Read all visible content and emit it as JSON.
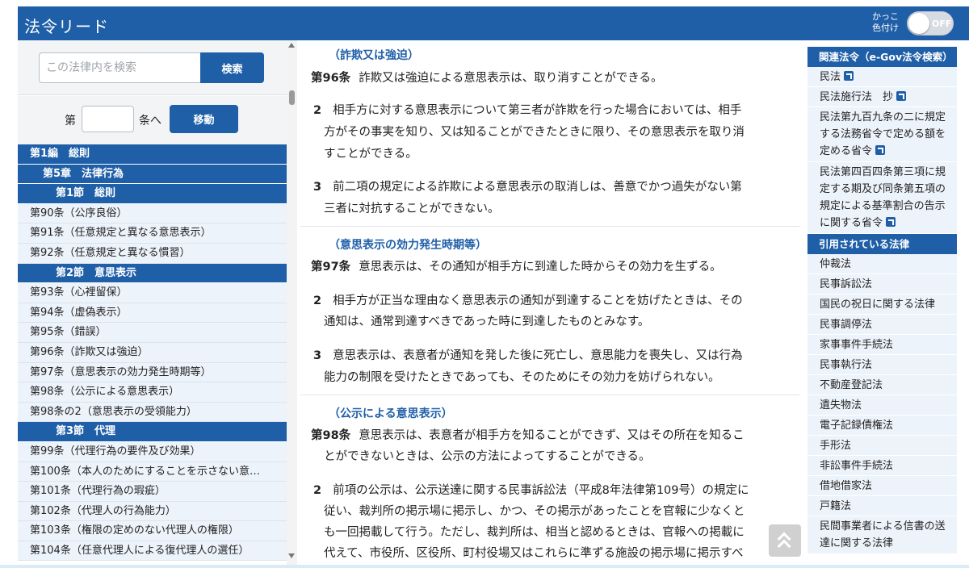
{
  "header": {
    "title": "法令リード",
    "toggle_label_1": "かっこ",
    "toggle_label_2": "色付け",
    "toggle_state": "OFF"
  },
  "search": {
    "placeholder": "この法律内を検索",
    "button": "検索"
  },
  "jump": {
    "prefix": "第",
    "suffix": "条へ",
    "button": "移動"
  },
  "toc": [
    {
      "label": "第1編　総則",
      "kind": "head",
      "level": 0
    },
    {
      "label": "第5章　法律行為",
      "kind": "head",
      "level": 1
    },
    {
      "label": "第1節　総則",
      "kind": "head",
      "level": 2
    },
    {
      "label": "第90条（公序良俗）",
      "kind": "art"
    },
    {
      "label": "第91条（任意規定と異なる意思表示）",
      "kind": "art"
    },
    {
      "label": "第92条（任意規定と異なる慣習）",
      "kind": "art"
    },
    {
      "label": "第2節　意思表示",
      "kind": "head",
      "level": 2
    },
    {
      "label": "第93条（心裡留保）",
      "kind": "art"
    },
    {
      "label": "第94条（虚偽表示）",
      "kind": "art"
    },
    {
      "label": "第95条（錯誤）",
      "kind": "art"
    },
    {
      "label": "第96条（詐欺又は強迫）",
      "kind": "art"
    },
    {
      "label": "第97条（意思表示の効力発生時期等）",
      "kind": "art"
    },
    {
      "label": "第98条（公示による意思表示）",
      "kind": "art"
    },
    {
      "label": "第98条の2（意思表示の受領能力）",
      "kind": "art"
    },
    {
      "label": "第3節　代理",
      "kind": "head",
      "level": 2
    },
    {
      "label": "第99条（代理行為の要件及び効果）",
      "kind": "art"
    },
    {
      "label": "第100条（本人のためにすることを示さない意…",
      "kind": "art"
    },
    {
      "label": "第101条（代理行為の瑕疵）",
      "kind": "art"
    },
    {
      "label": "第102条（代理人の行為能力）",
      "kind": "art"
    },
    {
      "label": "第103条（権限の定めのない代理人の権限）",
      "kind": "art"
    },
    {
      "label": "第104条（任意代理人による復代理人の選任）",
      "kind": "art"
    }
  ],
  "articles": [
    {
      "caption": "（詐欺又は強迫）",
      "number": "第96条",
      "first_line": "詐欺又は強迫による意思表示は、取り消すことができる。",
      "paragraphs": [
        {
          "num": "2",
          "lines": [
            "相手方に対する意思表示について第三者が詐欺を行った場合においては、相手",
            "方がその事実を知り、又は知ることができたときに限り、その意思表示を取り消",
            "すことができる。"
          ]
        },
        {
          "num": "3",
          "lines": [
            "前二項の規定による詐欺による意思表示の取消しは、善意でかつ過失がない第",
            "三者に対抗することができない。"
          ]
        }
      ]
    },
    {
      "caption": "（意思表示の効力発生時期等）",
      "number": "第97条",
      "first_line": "意思表示は、その通知が相手方に到達した時からその効力を生ずる。",
      "paragraphs": [
        {
          "num": "2",
          "lines": [
            "相手方が正当な理由なく意思表示の通知が到達することを妨げたときは、その",
            "通知は、通常到達すべきであった時に到達したものとみなす。"
          ]
        },
        {
          "num": "3",
          "lines": [
            "意思表示は、表意者が通知を発した後に死亡し、意思能力を喪失し、又は行為",
            "能力の制限を受けたときであっても、そのためにその効力を妨げられない。"
          ]
        }
      ]
    },
    {
      "caption": "（公示による意思表示）",
      "number": "第98条",
      "first_line": "意思表示は、表意者が相手方を知ることができず、又はその所在を知るこ",
      "first_cont": "とができないときは、公示の方法によってすることができる。",
      "paragraphs": [
        {
          "num": "2",
          "lines": [
            "前項の公示は、公示送達に関する民事訴訟法（平成8年法律第109号）の規定に",
            "従い、裁判所の掲示場に掲示し、かつ、その掲示があったことを官報に少なくと",
            "も一回掲載して行う。ただし、裁判所は、相当と認めるときは、官報への掲載に",
            "代えて、市役所、区役所、町村役場又はこれらに準ずる施設の掲示場に掲示すべ"
          ]
        }
      ]
    }
  ],
  "related": {
    "heading": "関連法令（e-Gov法令検索）",
    "items": [
      {
        "text": "民法",
        "ext": true
      },
      {
        "text": "民法施行法　抄",
        "ext": true
      },
      {
        "lines": [
          "民法第九百九条の二に規定",
          "する法務省令で定める額を",
          "定める省令"
        ],
        "ext": true
      },
      {
        "lines": [
          "民法第四百四条第三項に規",
          "定する期及び同条第五項の",
          "規定による基準割合の告示",
          "に関する省令"
        ],
        "ext": true
      }
    ]
  },
  "cited": {
    "heading": "引用されている法律",
    "items": [
      {
        "text": "仲裁法"
      },
      {
        "text": "民事訴訟法"
      },
      {
        "text": "国民の祝日に関する法律"
      },
      {
        "text": "民事調停法"
      },
      {
        "text": "家事事件手続法"
      },
      {
        "text": "民事執行法"
      },
      {
        "text": "不動産登記法"
      },
      {
        "text": "遺失物法"
      },
      {
        "text": "電子記録債権法"
      },
      {
        "text": "手形法"
      },
      {
        "text": "非訟事件手続法"
      },
      {
        "text": "借地借家法"
      },
      {
        "text": "戸籍法"
      },
      {
        "lines": [
          "民間事業者による信書の送",
          "達に関する法律"
        ]
      }
    ]
  },
  "icons": {
    "external_link": "external-link-icon",
    "scroll_top": "chevrons-up-icon"
  },
  "colors": {
    "brand": "#1f5fa8",
    "toc_item_bg": "#edf3fb"
  }
}
